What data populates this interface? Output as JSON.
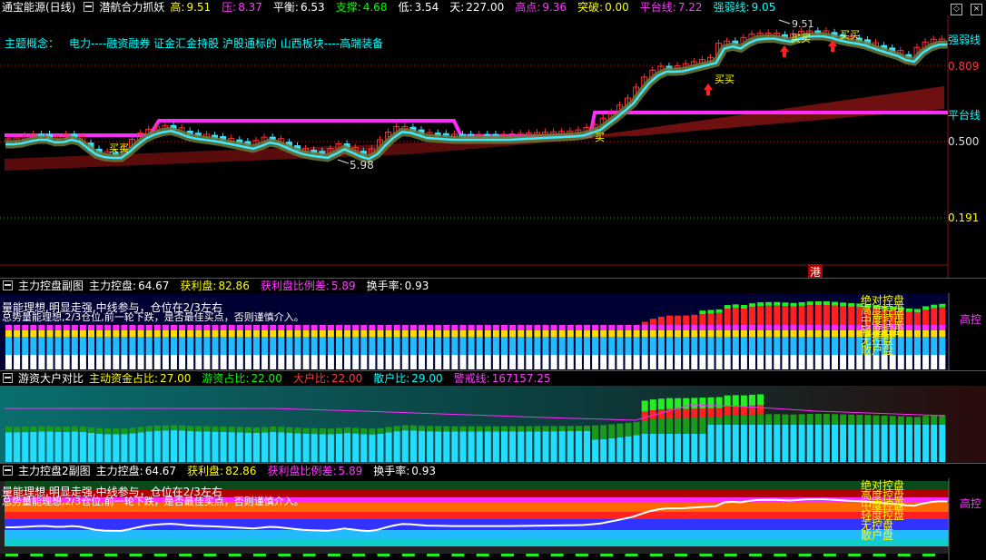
{
  "main": {
    "title": "通宝能源(日线)",
    "indicator": "潜航合力抓妖",
    "stats": [
      {
        "label": "高:",
        "value": "9.51",
        "color": "#ffff00"
      },
      {
        "label": "压:",
        "value": "8.37",
        "color": "#ff3bff"
      },
      {
        "label": "平衡:",
        "value": "6.53",
        "color": "#ffffff"
      },
      {
        "label": "支撑:",
        "value": "4.68",
        "color": "#00ff00"
      },
      {
        "label": "低:",
        "value": "3.54",
        "color": "#ffffff"
      },
      {
        "label": "天:",
        "value": "227.00",
        "color": "#ffffff"
      },
      {
        "label": "高点:",
        "value": "9.36",
        "color": "#ff3bff"
      },
      {
        "label": "突破:",
        "value": "0.00",
        "color": "#ffff00"
      },
      {
        "label": "平台线:",
        "value": "7.22",
        "color": "#ff3bff"
      },
      {
        "label": "强弱线:",
        "value": "9.05",
        "color": "#00ffff"
      }
    ],
    "theme_label": "主题概念：",
    "theme_text": "电力----融资融券 证金汇金持股 沪股通标的 山西板块----高端装备",
    "right_labels": {
      "strong": "强弱线",
      "platform": "平台线",
      "v1": "0.809",
      "v2": "0.500",
      "v3": "0.191"
    },
    "annotations": {
      "buy": "买",
      "buy2": "买买",
      "low_price": "5.98",
      "high_price": "9.51",
      "gang": "港"
    }
  },
  "sub1": {
    "title": "主力控盘副图",
    "stats": [
      {
        "label": "主力控盘:",
        "value": "64.67",
        "color": "#ffffff"
      },
      {
        "label": "获利盘:",
        "value": "82.86",
        "color": "#ffff00"
      },
      {
        "label": "获利盘比例差:",
        "value": "5.89",
        "color": "#ff3bff"
      },
      {
        "label": "换手率:",
        "value": "0.93",
        "color": "#ffffff"
      }
    ],
    "note1": "量能理想,明显走强,中线参与，仓位在2/3左右",
    "note2": "总势量能理想,2/3仓位,前一轮下跌，是否最佳买点，否则谨慎介入。",
    "legend": [
      "绝对控盘",
      "高度控盘",
      "中度控盘",
      "轻度控盘",
      "无控盘",
      "散户盘"
    ],
    "right": "高控"
  },
  "sub2": {
    "title": "游资大户对比",
    "stats": [
      {
        "label": "主动资金占比:",
        "value": "27.00",
        "color": "#ffff00"
      },
      {
        "label": "游资占比:",
        "value": "22.00",
        "color": "#00ff00"
      },
      {
        "label": "大户比:",
        "value": "22.00",
        "color": "#ff3b3b"
      },
      {
        "label": "散户比:",
        "value": "29.00",
        "color": "#00ffff"
      },
      {
        "label": "警戒线:",
        "value": "167157.25",
        "color": "#ff3bff"
      }
    ]
  },
  "sub3": {
    "title": "主力控盘2副图",
    "stats": [
      {
        "label": "主力控盘:",
        "value": "64.67",
        "color": "#ffffff"
      },
      {
        "label": "获利盘:",
        "value": "82.86",
        "color": "#ffff00"
      },
      {
        "label": "获利盘比例差:",
        "value": "5.89",
        "color": "#ff3bff"
      },
      {
        "label": "换手率:",
        "value": "0.93",
        "color": "#ffffff"
      }
    ],
    "note1": "量能理想,明显走强,中线参与，仓位在2/3左右",
    "note2": "总势量能理想,2/3仓位,前一轮下跌，是否最佳买点，否则谨慎介入。",
    "legend": [
      "绝对控盘",
      "高度控盘",
      "中度控盘",
      "轻度控盘",
      "无控盘",
      "散户盘"
    ],
    "right": "高控"
  }
}
